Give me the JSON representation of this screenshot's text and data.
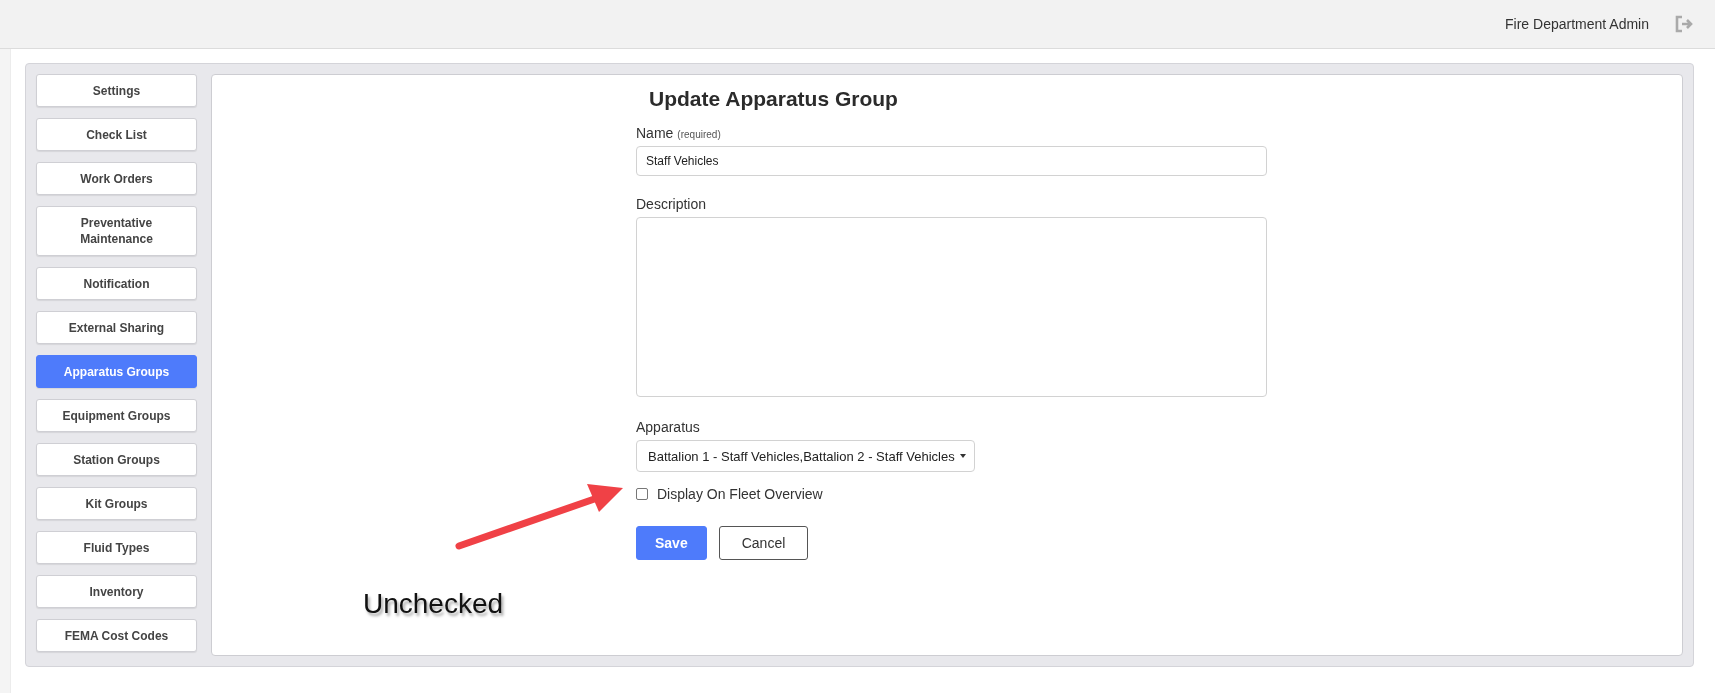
{
  "header": {
    "user": "Fire Department Admin"
  },
  "sidebar": {
    "items": [
      {
        "label": "Settings",
        "selected": false
      },
      {
        "label": "Check List",
        "selected": false
      },
      {
        "label": "Work Orders",
        "selected": false
      },
      {
        "label": "Preventative Maintenance",
        "selected": false
      },
      {
        "label": "Notification",
        "selected": false
      },
      {
        "label": "External Sharing",
        "selected": false
      },
      {
        "label": "Apparatus Groups",
        "selected": true
      },
      {
        "label": "Equipment Groups",
        "selected": false
      },
      {
        "label": "Station Groups",
        "selected": false
      },
      {
        "label": "Kit Groups",
        "selected": false
      },
      {
        "label": "Fluid Types",
        "selected": false
      },
      {
        "label": "Inventory",
        "selected": false
      },
      {
        "label": "FEMA Cost Codes",
        "selected": false
      }
    ]
  },
  "form": {
    "title": "Update Apparatus Group",
    "fields": [
      {
        "kind": "text",
        "label": "Name",
        "hint": "(required)",
        "value": "Staff Vehicles"
      },
      {
        "kind": "textarea",
        "label": "Description"
      },
      {
        "kind": "select",
        "label": "Apparatus",
        "value": "Battalion 1 - Staff Vehicles,Battalion 2 - Staff Vehicles"
      },
      {
        "kind": "checkbox",
        "label": "Display On Fleet Overview",
        "checked": false
      }
    ],
    "buttons": [
      {
        "label": "Save",
        "kind": "primary"
      },
      {
        "label": "Cancel",
        "kind": "secondary"
      }
    ]
  },
  "annotation": {
    "text": "Unchecked"
  }
}
